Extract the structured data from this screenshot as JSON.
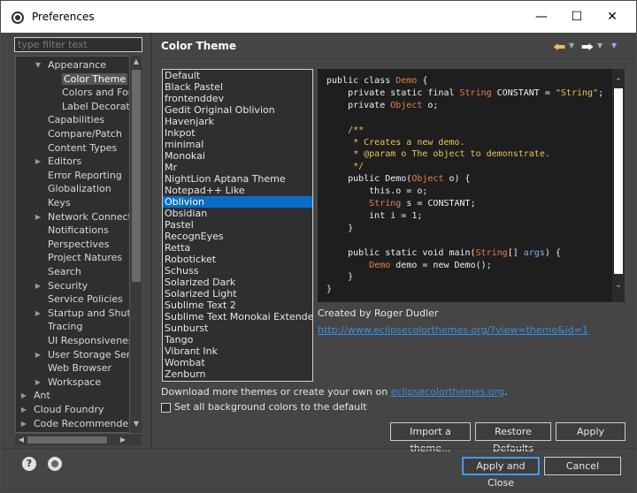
{
  "window": {
    "title": "Preferences",
    "icons": {
      "app": "eclipse-icon",
      "minimize": "minimize-icon",
      "maximize": "maximize-icon",
      "close": "close-icon"
    }
  },
  "filter": {
    "placeholder": "type filter text"
  },
  "tree": {
    "items": [
      {
        "label": "Appearance",
        "level": 1,
        "twisty": "expanded"
      },
      {
        "label": "Color Theme",
        "level": 2,
        "twisty": "none",
        "selected": true
      },
      {
        "label": "Colors and Fonts",
        "level": 2,
        "twisty": "none"
      },
      {
        "label": "Label Decorations",
        "level": 2,
        "twisty": "none"
      },
      {
        "label": "Capabilities",
        "level": 1,
        "twisty": "none"
      },
      {
        "label": "Compare/Patch",
        "level": 1,
        "twisty": "none"
      },
      {
        "label": "Content Types",
        "level": 1,
        "twisty": "none"
      },
      {
        "label": "Editors",
        "level": 1,
        "twisty": "collapsed"
      },
      {
        "label": "Error Reporting",
        "level": 1,
        "twisty": "none"
      },
      {
        "label": "Globalization",
        "level": 1,
        "twisty": "none"
      },
      {
        "label": "Keys",
        "level": 1,
        "twisty": "none"
      },
      {
        "label": "Network Connections",
        "level": 1,
        "twisty": "collapsed"
      },
      {
        "label": "Notifications",
        "level": 1,
        "twisty": "none"
      },
      {
        "label": "Perspectives",
        "level": 1,
        "twisty": "none"
      },
      {
        "label": "Project Natures",
        "level": 1,
        "twisty": "none"
      },
      {
        "label": "Search",
        "level": 1,
        "twisty": "none"
      },
      {
        "label": "Security",
        "level": 1,
        "twisty": "collapsed"
      },
      {
        "label": "Service Policies",
        "level": 1,
        "twisty": "none"
      },
      {
        "label": "Startup and Shutdown",
        "level": 1,
        "twisty": "collapsed"
      },
      {
        "label": "Tracing",
        "level": 1,
        "twisty": "none"
      },
      {
        "label": "UI Responsiveness Monitoring",
        "level": 1,
        "twisty": "none"
      },
      {
        "label": "User Storage Service",
        "level": 1,
        "twisty": "collapsed"
      },
      {
        "label": "Web Browser",
        "level": 1,
        "twisty": "none"
      },
      {
        "label": "Workspace",
        "level": 1,
        "twisty": "collapsed"
      },
      {
        "label": "Ant",
        "level": 0,
        "twisty": "collapsed"
      },
      {
        "label": "Cloud Foundry",
        "level": 0,
        "twisty": "collapsed"
      },
      {
        "label": "Code Recommenders",
        "level": 0,
        "twisty": "collapsed"
      }
    ]
  },
  "page": {
    "title": "Color Theme"
  },
  "themes": {
    "items": [
      "Default",
      "Black Pastel",
      "frontenddev",
      "Gedit Original Oblivion",
      "Havenjark",
      "Inkpot",
      "minimal",
      "Monokai",
      "Mr",
      "NightLion Aptana Theme",
      "Notepad++ Like",
      "Oblivion",
      "Obsidian",
      "Pastel",
      "RecognEyes",
      "Retta",
      "Roboticket",
      "Schuss",
      "Solarized Dark",
      "Solarized Light",
      "Sublime Text 2",
      "Sublime Text Monokai Extended",
      "Sunburst",
      "Tango",
      "Vibrant Ink",
      "Wombat",
      "Zenburn"
    ],
    "selected": "Oblivion"
  },
  "code": {
    "lines": [
      [
        {
          "t": "public class ",
          "c": "kw"
        },
        {
          "t": "Demo",
          "c": "ty"
        },
        {
          "t": " {",
          "c": "kw"
        }
      ],
      [
        {
          "t": "    private static final ",
          "c": "kw"
        },
        {
          "t": "String",
          "c": "ty"
        },
        {
          "t": " CONSTANT = ",
          "c": "kw"
        },
        {
          "t": "\"String\"",
          "c": "st"
        },
        {
          "t": ";",
          "c": "kw"
        }
      ],
      [
        {
          "t": "    private ",
          "c": "kw"
        },
        {
          "t": "Object",
          "c": "ty"
        },
        {
          "t": " o;",
          "c": "kw"
        }
      ],
      [
        {
          "t": "",
          "c": "kw"
        }
      ],
      [
        {
          "t": "    /**",
          "c": "cm"
        }
      ],
      [
        {
          "t": "     * Creates a new demo.",
          "c": "cm"
        }
      ],
      [
        {
          "t": "     * @param o The object to demonstrate.",
          "c": "cm"
        }
      ],
      [
        {
          "t": "     */",
          "c": "cm"
        }
      ],
      [
        {
          "t": "    public Demo(",
          "c": "kw"
        },
        {
          "t": "Object",
          "c": "ty"
        },
        {
          "t": " o) {",
          "c": "kw"
        }
      ],
      [
        {
          "t": "        this.o = o;",
          "c": "kw"
        }
      ],
      [
        {
          "t": "        ",
          "c": "kw"
        },
        {
          "t": "String",
          "c": "ty"
        },
        {
          "t": " s = CONSTANT;",
          "c": "kw"
        }
      ],
      [
        {
          "t": "        int i = 1;",
          "c": "kw"
        }
      ],
      [
        {
          "t": "    }",
          "c": "kw"
        }
      ],
      [
        {
          "t": "",
          "c": "kw"
        }
      ],
      [
        {
          "t": "    public static void main(",
          "c": "kw"
        },
        {
          "t": "String",
          "c": "ty"
        },
        {
          "t": "[] ",
          "c": "kw"
        },
        {
          "t": "args",
          "c": "nm"
        },
        {
          "t": ") {",
          "c": "kw"
        }
      ],
      [
        {
          "t": "        ",
          "c": "kw"
        },
        {
          "t": "Demo",
          "c": "ty"
        },
        {
          "t": " demo = new Demo();",
          "c": "kw"
        }
      ],
      [
        {
          "t": "    }",
          "c": "kw"
        }
      ],
      [
        {
          "t": "}",
          "c": "kw"
        }
      ]
    ]
  },
  "author": {
    "label": "Created by Roger Dudler",
    "link": "http://www.eclipsecolorthemes.org/?view=theme&id=1"
  },
  "download": {
    "prefix": "Download more themes or create your own on ",
    "link": "eclipsecolorthemes.org",
    "suffix": "."
  },
  "option": {
    "label": "Set all background colors to the default",
    "checked": false
  },
  "buttons": {
    "import": "Import a theme...",
    "restore": "Restore Defaults",
    "apply": "Apply",
    "apply_close": "Apply and Close",
    "cancel": "Cancel"
  },
  "icons": {
    "help": "help-icon",
    "settings": "oomph-settings-icon",
    "back": "back-arrow-icon",
    "forward": "forward-arrow-icon",
    "menu": "view-menu-icon"
  },
  "colors": {
    "accent": "#0b6cc6",
    "link": "#3b8fe6",
    "nav_back": "#e8c26a"
  }
}
